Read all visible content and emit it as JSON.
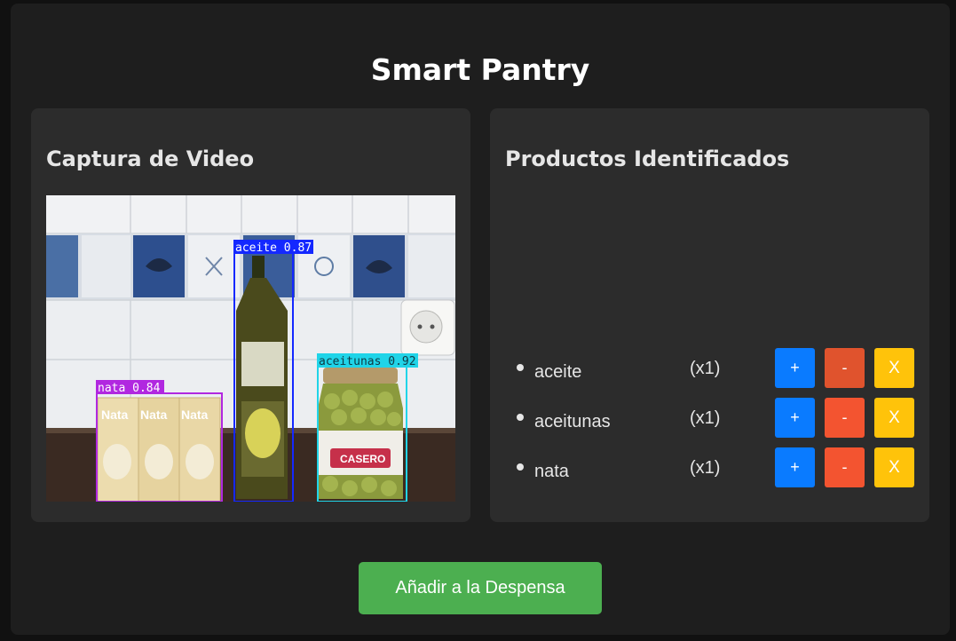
{
  "app": {
    "title": "Smart Pantry"
  },
  "video_panel": {
    "title": "Captura de Video",
    "detections": [
      {
        "label": "aceite",
        "confidence": "0.87",
        "color": "#1428ff",
        "text": "aceite 0.87"
      },
      {
        "label": "aceitunas",
        "confidence": "0.92",
        "color": "#20d4e8",
        "text": "aceitunas 0.92"
      },
      {
        "label": "nata",
        "confidence": "0.84",
        "color": "#b128e0",
        "text": "nata 0.84"
      }
    ],
    "packaging_text": {
      "carton_brand": "Nata",
      "jar_label": "CASERO"
    }
  },
  "products_panel": {
    "title": "Productos Identificados",
    "items": [
      {
        "name": "aceite",
        "qty": "(x1)"
      },
      {
        "name": "aceitunas",
        "qty": "(x1)"
      },
      {
        "name": "nata",
        "qty": "(x1)"
      }
    ],
    "buttons": {
      "plus": "+",
      "minus": "-",
      "remove": "X"
    }
  },
  "actions": {
    "add_to_pantry": "Añadir a la Despensa"
  },
  "colors": {
    "background": "#1e1e1e",
    "panel": "#2c2c2c",
    "plus": "#0a7bff",
    "minus": "#f35430",
    "remove": "#ffc30a",
    "add": "#4caf50"
  }
}
